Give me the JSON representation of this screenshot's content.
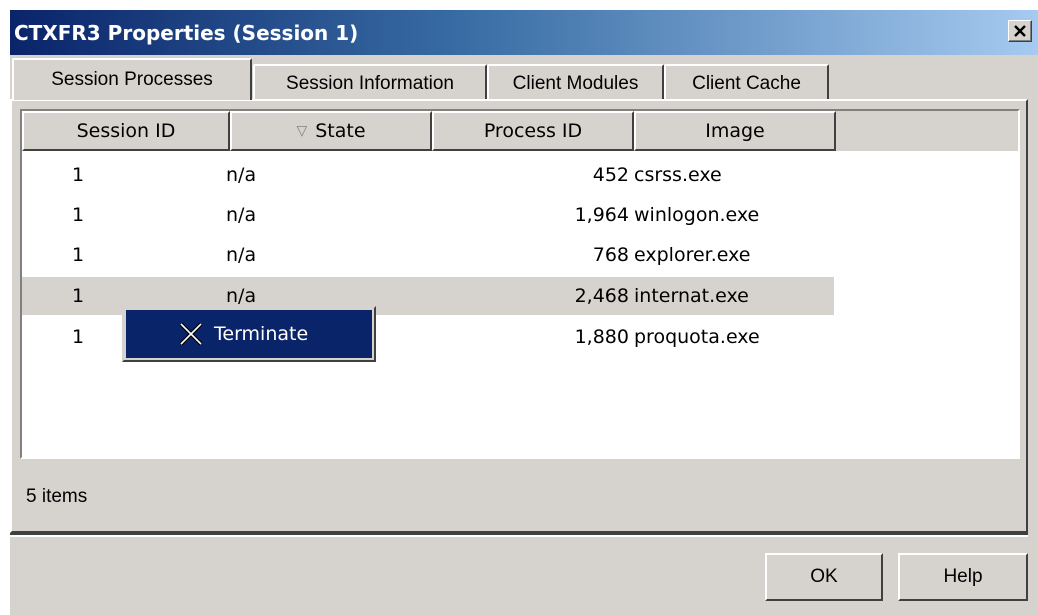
{
  "window": {
    "title": "CTXFR3 Properties (Session 1)",
    "close_glyph": "✕"
  },
  "tabs": [
    {
      "label": "Session Processes",
      "active": true
    },
    {
      "label": "Session Information",
      "active": false
    },
    {
      "label": "Client Modules",
      "active": false
    },
    {
      "label": "Client Cache",
      "active": false
    }
  ],
  "list": {
    "columns": [
      "Session ID",
      "State",
      "Process ID",
      "Image"
    ],
    "sort_indicator": "▽",
    "rows": [
      {
        "session_id": "1",
        "state": "n/a",
        "process_id": "452",
        "image": "csrss.exe"
      },
      {
        "session_id": "1",
        "state": "n/a",
        "process_id": "1,964",
        "image": "winlogon.exe"
      },
      {
        "session_id": "1",
        "state": "n/a",
        "process_id": "768",
        "image": "explorer.exe"
      },
      {
        "session_id": "1",
        "state": "n/a",
        "process_id": "2,468",
        "image": "internat.exe",
        "selected": true
      },
      {
        "session_id": "1",
        "state": "",
        "process_id": "1,880",
        "image": "proquota.exe"
      }
    ]
  },
  "context_menu": {
    "items": [
      {
        "label": "Terminate",
        "icon": "x-cursor-icon"
      }
    ]
  },
  "status": {
    "text": "5 items"
  },
  "buttons": {
    "ok": "OK",
    "help": "Help"
  },
  "colors": {
    "title_active_start": "#0a246a",
    "title_active_end": "#a6caf0",
    "face": "#d6d3ce",
    "highlight": "#0a246a"
  }
}
